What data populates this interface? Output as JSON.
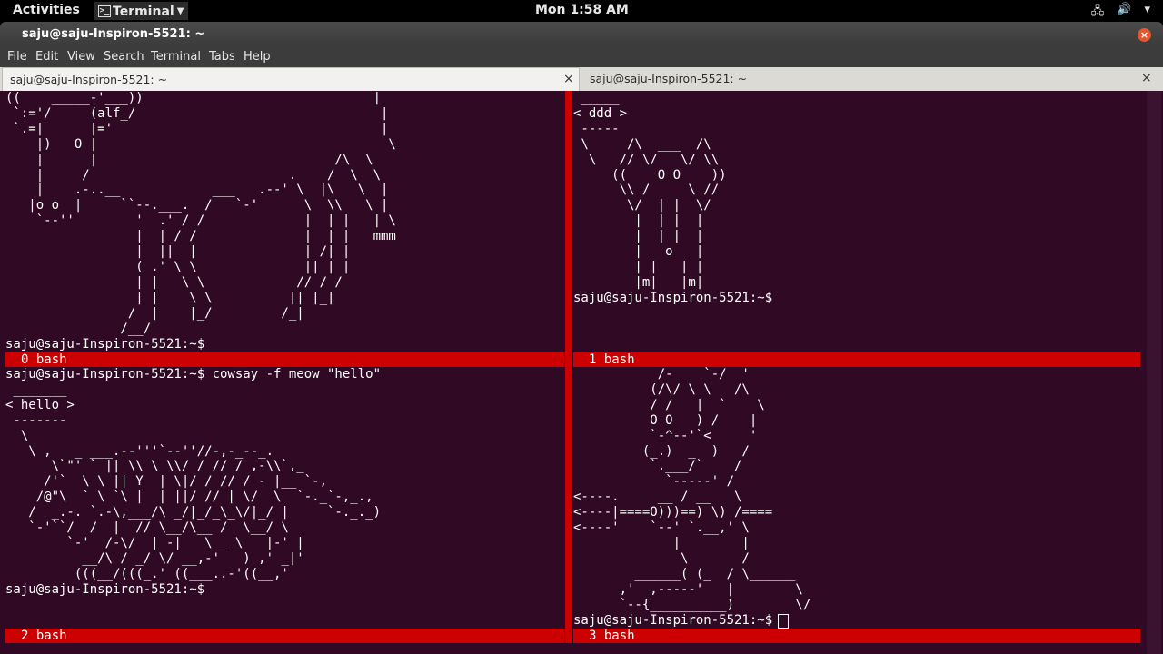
{
  "topbar": {
    "activities": "Activities",
    "app_menu": "Terminal",
    "app_icon": ">_",
    "clock": "Mon  1:58 AM",
    "tray_icons": [
      "network-icon",
      "volume-icon",
      "power-icon"
    ]
  },
  "window": {
    "title": "saju@saju-Inspiron-5521: ~",
    "close_glyph": "×"
  },
  "menu": [
    "File",
    "Edit",
    "View",
    "Search",
    "Terminal",
    "Tabs",
    "Help"
  ],
  "tabs": [
    {
      "label": "saju@saju-Inspiron-5521: ~",
      "close": "×",
      "active": true
    },
    {
      "label": "saju@saju-Inspiron-5521: ~",
      "close": "×",
      "active": false
    }
  ],
  "panes": [
    {
      "text": "((    _____-'___))                              |\n `:='/     (alf_/                                |\n `.=|      |='                                   |\n    |)   O |                                      \\\n    |      |                               /\\  \\\n    |     /                          .    /  \\  \\\n    |    .-..__            ___   .--' \\  |\\   \\  |\n   |o o  |     ``--.___.  /   `-'      \\  \\\\   \\ |\n    `--''        '  .' / /             |  | |   | \\\n                 |  | / /              |  | |   mmm\n                 |  ||  |              | /| |\n                 ( .' \\ \\              || | |\n                 | |   \\ \\            // / /\n                 | |    \\ \\          || |_|\n                /  |    |_/         /_|\n               /__/\nsaju@saju-Inspiron-5521:~$",
      "status": "0 bash"
    },
    {
      "text": " _____\n< ddd >\n -----\n \\     /\\  ___  /\\\n  \\   // \\/   \\/ \\\\\n     ((    O O    ))\n      \\\\ /     \\ //\n       \\/  | |  \\/\n        |  | |  |\n        |  | |  |\n        |   o   |\n        | |   | |\n        |m|   |m|\nsaju@saju-Inspiron-5521:~$",
      "status": "1 bash"
    },
    {
      "text": "saju@saju-Inspiron-5521:~$ cowsay -f meow \"hello\"\n _______\n< hello >\n -------\n  \\\n   \\ ,   _ ___.--'''`--''//-,-_--_.\n      \\`\"' ` || \\\\ \\ \\\\/ / // / ,-\\\\`,_\n     /'`  \\ \\ || Y  | \\|/ / // / - |__ `-,\n    /@\"\\  ` \\ `\\ |  | ||/ // | \\/  \\  `-._`-,_.,\n   /  _.-. `.-\\,___/\\ _/|_/_\\_\\/|_/ |     `-._._)\n   `-'``/  /  |  // \\__/\\__ /  \\__/ \\\n        `-'  /-\\/  | -|   \\__ \\   |-' |\n          __/\\ / _/ \\/ __,-'   ) ,' _|'\n         (((__/(((_.' ((___..-'((__,'\nsaju@saju-Inspiron-5521:~$",
      "status": "2 bash"
    },
    {
      "text": "           /- _  `-/  '\n          (/\\/ \\ \\   /\\\n          / /   |  `    \\\n          O O   ) /    |\n          `-^--'`<     '\n         (_.)  _  )   /\n          `.___/`    /\n            `-----' /\n<----.     __ / __   \\\n<----|====O)))==) \\) /====\n<----'    `--' `.__,' \\\n             |        |\n              \\       /\n        ______( (_  / \\______\n      ,'  ,-----'   |        \\\n      `--{__________)        \\/\nsaju@saju-Inspiron-5521:~$ ",
      "status": "3 bash"
    }
  ]
}
